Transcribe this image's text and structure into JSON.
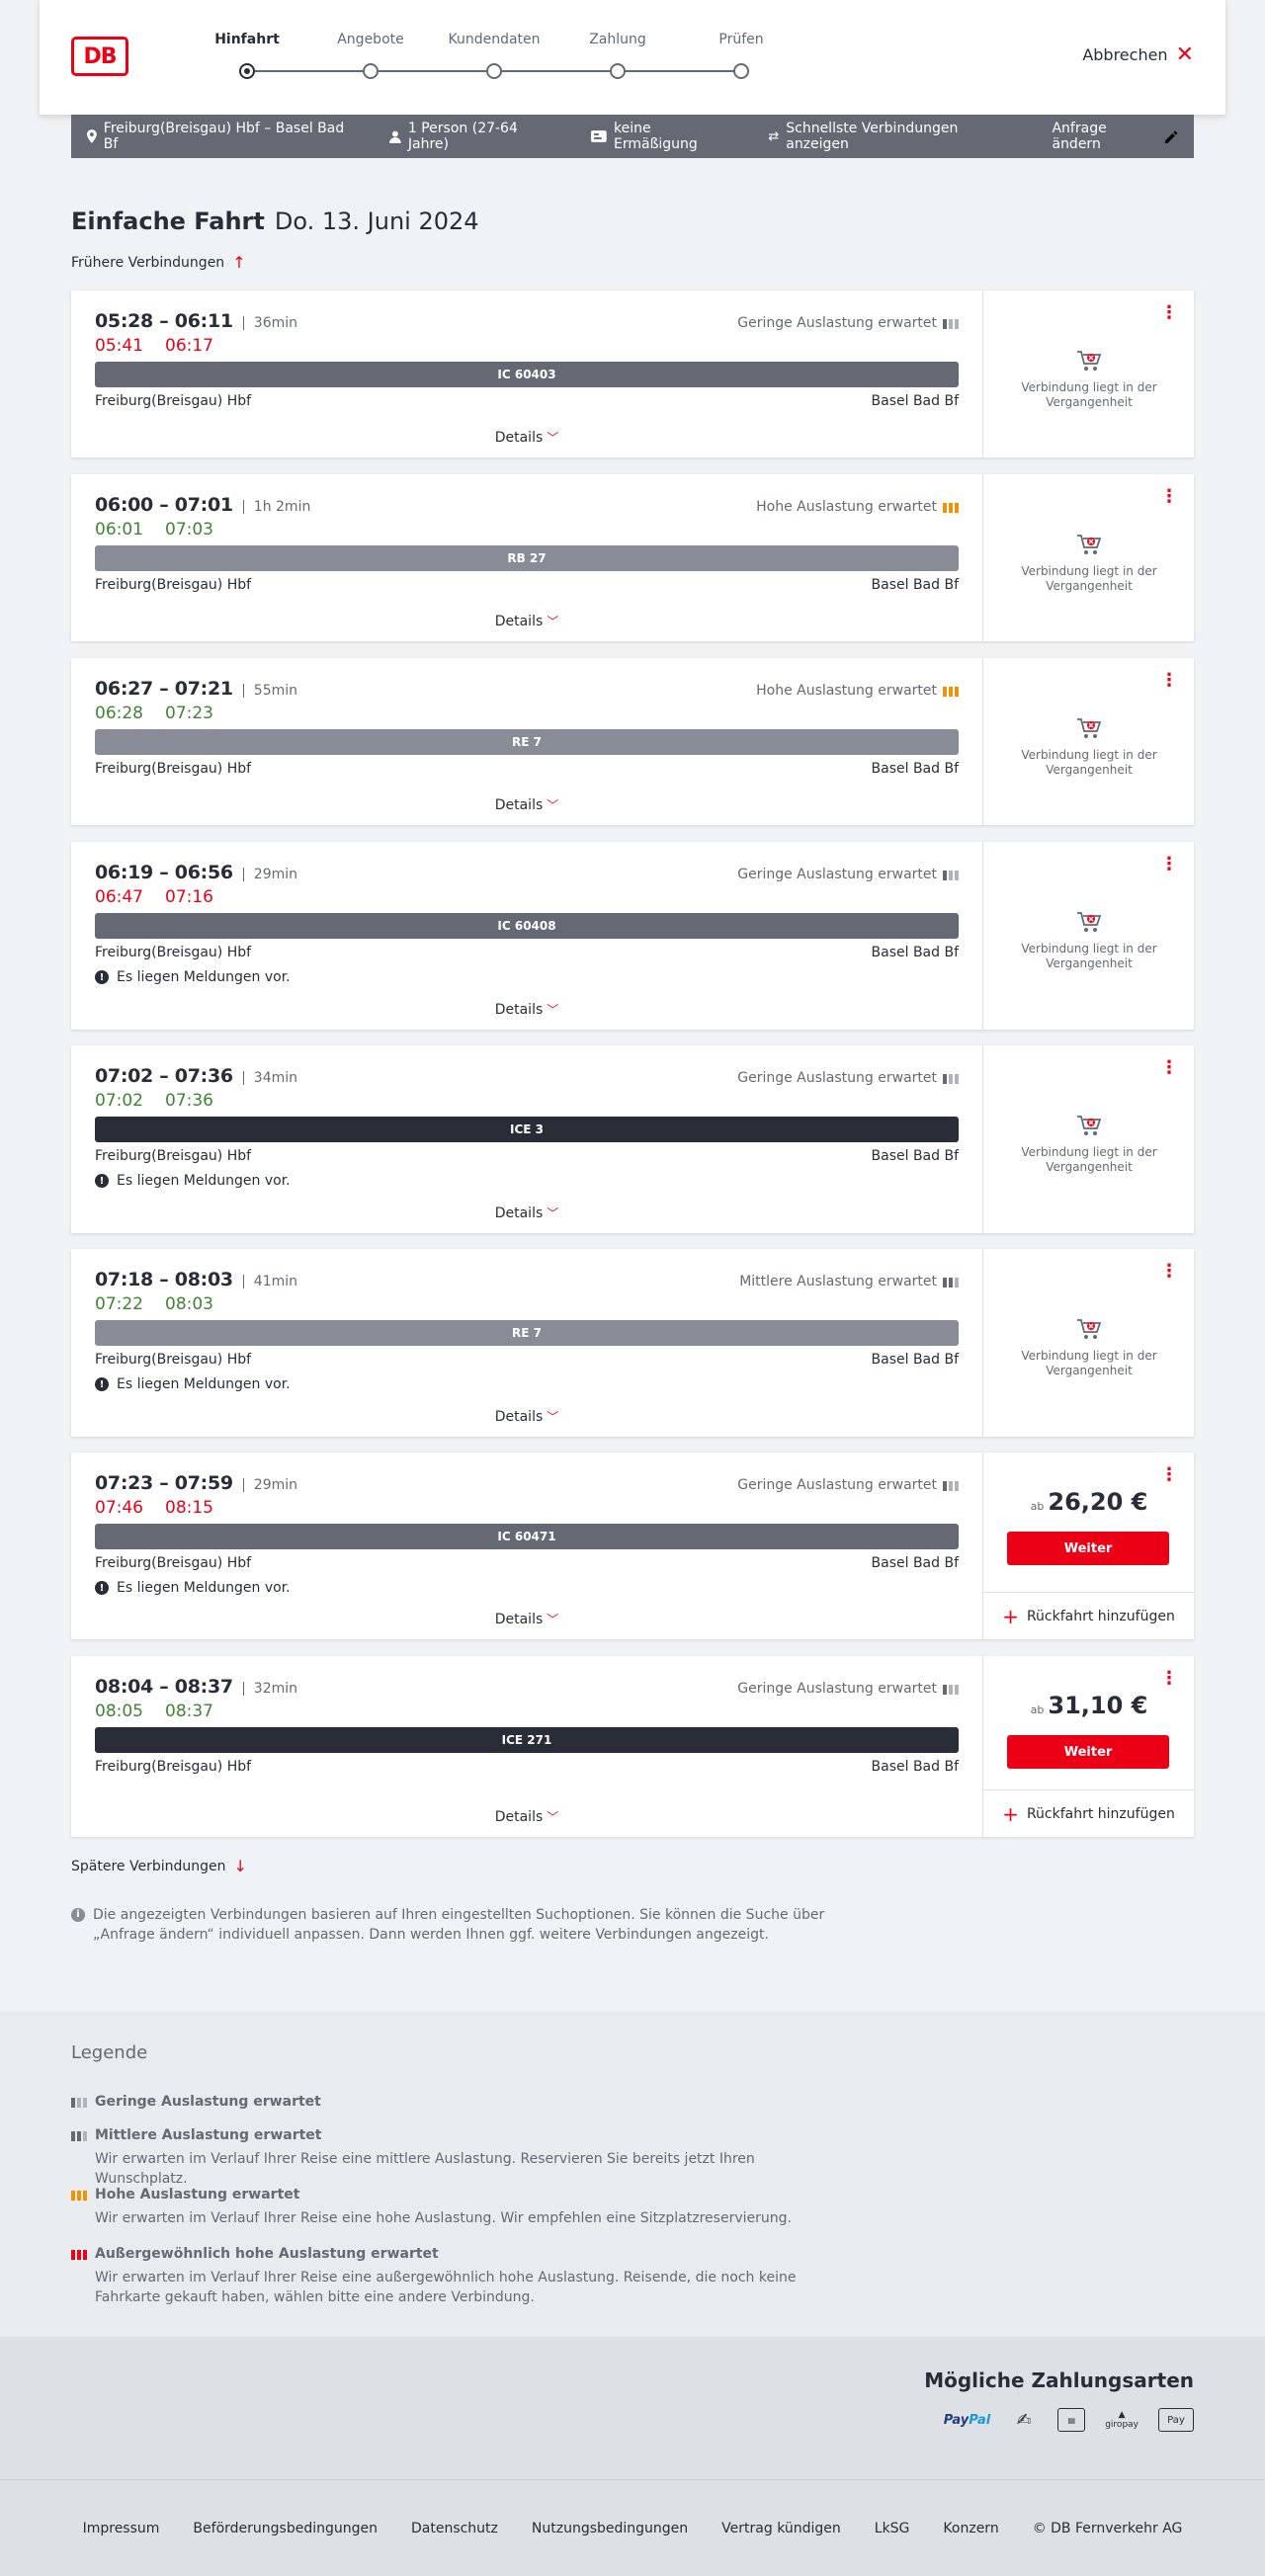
{
  "logo_text": "DB",
  "header": {
    "steps": [
      "Hinfahrt",
      "Angebote",
      "Kundendaten",
      "Zahlung",
      "Prüfen"
    ],
    "active_step": "Hinfahrt",
    "cancel_label": "Abbrechen"
  },
  "search": {
    "route": "Freiburg(Breisgau) Hbf – Basel Bad Bf",
    "passengers": "1 Person (27-64 Jahre)",
    "discount": "keine Ermäßigung",
    "fastest": "Schnellste Verbindungen anzeigen",
    "edit": "Anfrage ändern"
  },
  "title": {
    "type": "Einfache Fahrt",
    "date": "Do. 13. Juni 2024"
  },
  "earlier": "Frühere Verbindungen",
  "later": "Spätere Verbindungen",
  "details_label": "Details",
  "past_label": "Verbindung liegt in der Vergangenheit",
  "weiter_label": "Weiter",
  "return_label": "Rückfahrt hinzufügen",
  "price_prefix": "ab",
  "message_label": "Es liegen Meldungen vor.",
  "connections": [
    {
      "times": "05:28 – 06:11",
      "duration": "36min",
      "rt_dep": "05:41",
      "rt_arr": "06:17",
      "rt_status": "late",
      "occupancy": "Geringe Auslastung erwartet",
      "occ_level": "low",
      "train": "IC 60403",
      "train_kind": "ic",
      "from": "Freiburg(Breisgau) Hbf",
      "to": "Basel Bad Bf",
      "message": false,
      "past": true
    },
    {
      "times": "06:00 – 07:01",
      "duration": "1h 2min",
      "rt_dep": "06:01",
      "rt_arr": "07:03",
      "rt_status": "ok",
      "occupancy": "Hohe Auslastung erwartet",
      "occ_level": "high",
      "train": "RB 27",
      "train_kind": "reg",
      "from": "Freiburg(Breisgau) Hbf",
      "to": "Basel Bad Bf",
      "message": false,
      "past": true
    },
    {
      "times": "06:27 – 07:21",
      "duration": "55min",
      "rt_dep": "06:28",
      "rt_arr": "07:23",
      "rt_status": "ok",
      "occupancy": "Hohe Auslastung erwartet",
      "occ_level": "high",
      "train": "RE 7",
      "train_kind": "reg",
      "from": "Freiburg(Breisgau) Hbf",
      "to": "Basel Bad Bf",
      "message": false,
      "past": true
    },
    {
      "times": "06:19 – 06:56",
      "duration": "29min",
      "rt_dep": "06:47",
      "rt_arr": "07:16",
      "rt_status": "late",
      "occupancy": "Geringe Auslastung erwartet",
      "occ_level": "low",
      "train": "IC 60408",
      "train_kind": "ic",
      "from": "Freiburg(Breisgau) Hbf",
      "to": "Basel Bad Bf",
      "message": true,
      "past": true
    },
    {
      "times": "07:02 – 07:36",
      "duration": "34min",
      "rt_dep": "07:02",
      "rt_arr": "07:36",
      "rt_status": "ok",
      "occupancy": "Geringe Auslastung erwartet",
      "occ_level": "low",
      "train": "ICE 3",
      "train_kind": "ice",
      "from": "Freiburg(Breisgau) Hbf",
      "to": "Basel Bad Bf",
      "message": true,
      "past": true
    },
    {
      "times": "07:18 – 08:03",
      "duration": "41min",
      "rt_dep": "07:22",
      "rt_arr": "08:03",
      "rt_status": "ok",
      "occupancy": "Mittlere Auslastung erwartet",
      "occ_level": "mid",
      "train": "RE 7",
      "train_kind": "reg",
      "from": "Freiburg(Breisgau) Hbf",
      "to": "Basel Bad Bf",
      "message": true,
      "past": true
    },
    {
      "times": "07:23 – 07:59",
      "duration": "29min",
      "rt_dep": "07:46",
      "rt_arr": "08:15",
      "rt_status": "late",
      "occupancy": "Geringe Auslastung erwartet",
      "occ_level": "low",
      "train": "IC 60471",
      "train_kind": "ic",
      "from": "Freiburg(Breisgau) Hbf",
      "to": "Basel Bad Bf",
      "message": true,
      "past": false,
      "price": "26,20 €"
    },
    {
      "times": "08:04 – 08:37",
      "duration": "32min",
      "rt_dep": "08:05",
      "rt_arr": "08:37",
      "rt_status": "ok",
      "occupancy": "Geringe Auslastung erwartet",
      "occ_level": "low",
      "train": "ICE 271",
      "train_kind": "ice",
      "from": "Freiburg(Breisgau) Hbf",
      "to": "Basel Bad Bf",
      "message": false,
      "past": false,
      "price": "31,10 €"
    }
  ],
  "info_text": "Die angezeigten Verbindungen basieren auf Ihren eingestellten Suchoptionen. Sie können die Suche über „Anfrage ändern“ individuell anpassen. Dann werden Ihnen ggf. weitere Verbindungen angezeigt.",
  "legend": {
    "title": "Legende",
    "items": [
      {
        "title": "Geringe Auslastung erwartet",
        "desc": "",
        "level": "low"
      },
      {
        "title": "Mittlere Auslastung erwartet",
        "desc": "Wir erwarten im Verlauf Ihrer Reise eine mittlere Auslastung. Reservieren Sie bereits jetzt Ihren Wunschplatz.",
        "level": "mid"
      },
      {
        "title": "Hohe Auslastung erwartet",
        "desc": "Wir erwarten im Verlauf Ihrer Reise eine hohe Auslastung. Wir empfehlen eine Sitzplatzreservierung.",
        "level": "high"
      },
      {
        "title": "Außergewöhnlich hohe Auslastung erwartet",
        "desc": "Wir erwarten im Verlauf Ihrer Reise eine außergewöhnlich hohe Auslastung. Reisende, die noch keine Fahrkarte gekauft haben, wählen bitte eine andere Verbindung.",
        "level": "ext"
      }
    ]
  },
  "payment": {
    "title": "Mögliche Zahlungsarten",
    "methods": [
      "PayPal",
      "Lastschrift",
      "Rechnung",
      "giropay",
      "Apple Pay"
    ],
    "paypal_a": "Pay",
    "paypal_b": "Pal",
    "giropay": "giropay",
    "applepay": "Pay"
  },
  "footer": [
    "Impressum",
    "Beförderungsbedingungen",
    "Datenschutz",
    "Nutzungsbedingungen",
    "Vertrag kündigen",
    "LkSG",
    "Konzern",
    "© DB Fernverkehr AG"
  ],
  "colors": {
    "accent": "#ec0016",
    "late": "#ec0016",
    "ontime": "#408335",
    "high_occupancy": "#f39200"
  }
}
